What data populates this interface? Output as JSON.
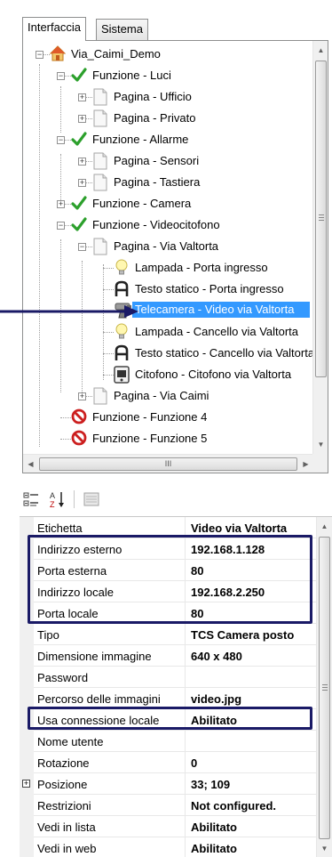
{
  "tabs": [
    {
      "label": "Interfaccia",
      "active": true
    },
    {
      "label": "Sistema",
      "active": false
    }
  ],
  "tree": {
    "nodes": [
      {
        "label": "Via_Caimi_Demo",
        "icon": "home-icon"
      },
      {
        "label": "Funzione - Luci",
        "icon": "check-icon"
      },
      {
        "label": "Pagina - Ufficio",
        "icon": "page-icon"
      },
      {
        "label": "Pagina - Privato",
        "icon": "page-icon"
      },
      {
        "label": "Funzione - Allarme",
        "icon": "check-icon"
      },
      {
        "label": "Pagina - Sensori",
        "icon": "page-icon"
      },
      {
        "label": "Pagina - Tastiera",
        "icon": "page-icon"
      },
      {
        "label": "Funzione - Camera",
        "icon": "check-icon"
      },
      {
        "label": "Funzione - Videocitofono",
        "icon": "check-icon"
      },
      {
        "label": "Pagina - Via Valtorta",
        "icon": "page-icon"
      },
      {
        "label": "Lampada - Porta ingresso",
        "icon": "bulb-icon"
      },
      {
        "label": "Testo statico - Porta ingresso",
        "icon": "text-icon"
      },
      {
        "label": "Telecamera - Video via Valtorta",
        "icon": "camera-icon",
        "selected": true
      },
      {
        "label": "Lampada - Cancello via Valtorta",
        "icon": "bulb-icon"
      },
      {
        "label": "Testo statico - Cancello via Valtorta",
        "icon": "text-icon"
      },
      {
        "label": "Citofono - Citofono via Valtorta",
        "icon": "intercom-icon"
      },
      {
        "label": "Pagina - Via Caimi",
        "icon": "page-icon"
      },
      {
        "label": "Funzione - Funzione 4",
        "icon": "blocked-icon"
      },
      {
        "label": "Funzione - Funzione 5",
        "icon": "blocked-icon"
      }
    ],
    "hscroll_grip": "III"
  },
  "properties": [
    {
      "name": "Etichetta",
      "value": "Video via Valtorta"
    },
    {
      "name": "Indirizzo esterno",
      "value": "192.168.1.128"
    },
    {
      "name": "Porta esterna",
      "value": "80"
    },
    {
      "name": "Indirizzo locale",
      "value": "192.168.2.250"
    },
    {
      "name": "Porta locale",
      "value": "80"
    },
    {
      "name": "Tipo",
      "value": "TCS Camera posto"
    },
    {
      "name": "Dimensione immagine",
      "value": "640 x 480"
    },
    {
      "name": "Password",
      "value": ""
    },
    {
      "name": "Percorso delle immagini",
      "value": "video.jpg"
    },
    {
      "name": "Usa connessione locale",
      "value": "Abilitato"
    },
    {
      "name": "Nome utente",
      "value": ""
    },
    {
      "name": "Rotazione",
      "value": "0"
    },
    {
      "name": "Posizione",
      "value": "33; 109",
      "expandable": true
    },
    {
      "name": "Restrizioni",
      "value": "Not configured."
    },
    {
      "name": "Vedi in lista",
      "value": "Abilitato"
    },
    {
      "name": "Vedi in web",
      "value": "Abilitato"
    }
  ],
  "colors": {
    "selection": "#3399ff",
    "annotation": "#1a1a66",
    "check": "#2ca02c",
    "blocked": "#cc1f1f"
  }
}
